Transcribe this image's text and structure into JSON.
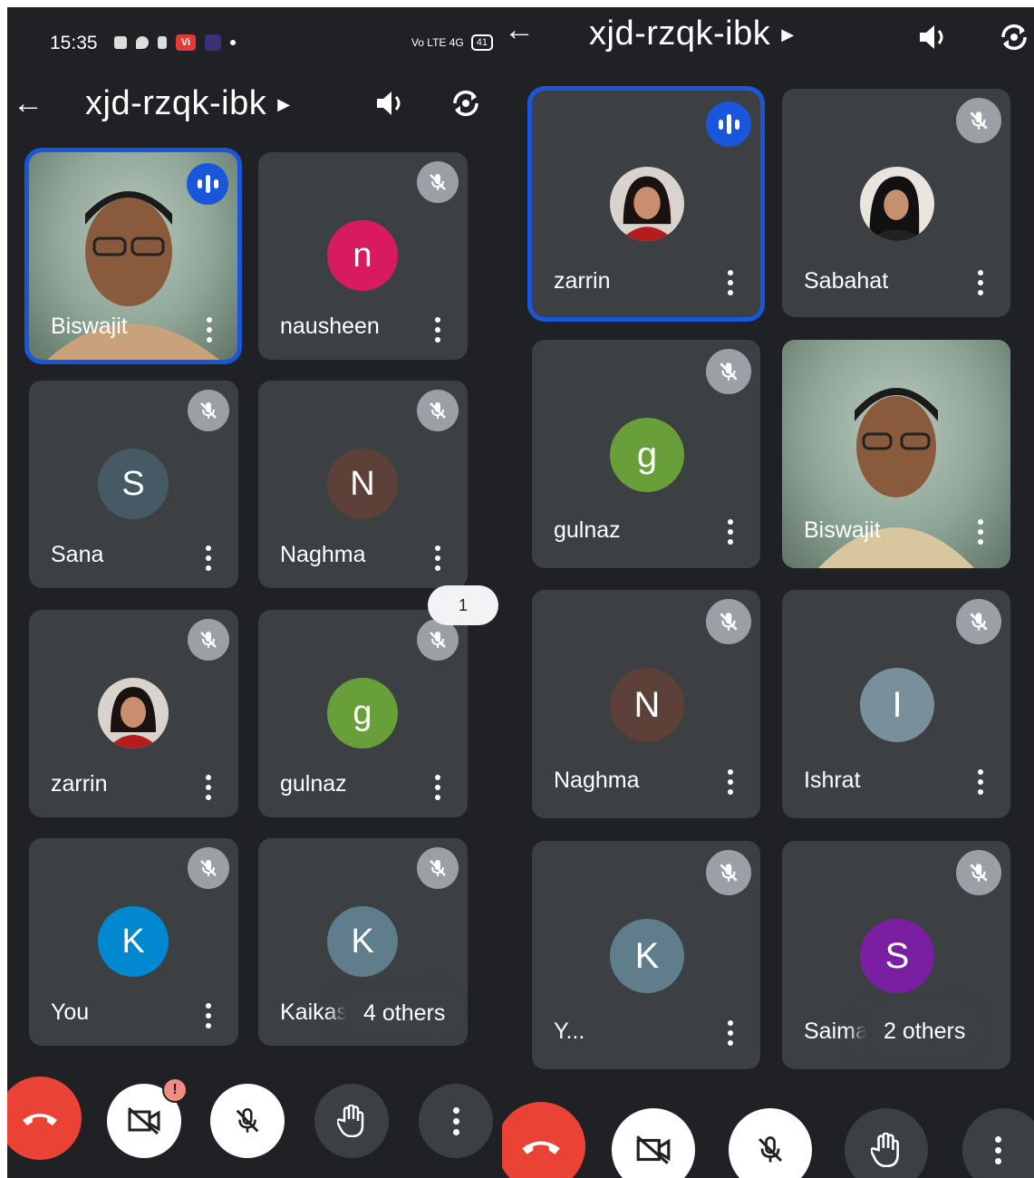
{
  "left": {
    "status": {
      "time": "15:35",
      "vi_badge": "Vi",
      "net": "Vo LTE 4G",
      "battery": "41"
    },
    "header": {
      "title": "xjd-rzqk-ibk",
      "back_icon": "back-arrow-icon",
      "speaker_icon": "speaker-icon",
      "switch_icon": "switch-camera-icon"
    },
    "tiles": [
      {
        "name": "Biswajit",
        "type": "video",
        "status": "speaking"
      },
      {
        "name": "nausheen",
        "type": "avatar",
        "initial": "n",
        "color": "#d81b60",
        "status": "muted"
      },
      {
        "name": "Sana",
        "type": "avatar",
        "initial": "S",
        "color": "#455a64",
        "status": "muted"
      },
      {
        "name": "Naghma",
        "type": "avatar",
        "initial": "N",
        "color": "#5d4037",
        "status": "muted"
      },
      {
        "name": "zarrin",
        "type": "photo",
        "status": "muted"
      },
      {
        "name": "gulnaz",
        "type": "avatar",
        "initial": "g",
        "color": "#689f38",
        "status": "muted"
      },
      {
        "name": "You",
        "type": "avatar",
        "initial": "K",
        "color": "#0288d1",
        "status": "muted"
      },
      {
        "name": "Kaikash",
        "type": "avatar",
        "initial": "K",
        "color": "#607d8b",
        "status": "muted",
        "overflow": "4 others"
      }
    ],
    "scroll_indicator": "1",
    "controls": {
      "alert": "!"
    }
  },
  "right": {
    "header": {
      "title": "xjd-rzqk-ibk"
    },
    "tiles": [
      {
        "name": "zarrin",
        "type": "photo",
        "status": "speaking"
      },
      {
        "name": "Sabahat",
        "type": "photo",
        "status": "muted"
      },
      {
        "name": "gulnaz",
        "type": "avatar",
        "initial": "g",
        "color": "#689f38",
        "status": "muted"
      },
      {
        "name": "Biswajit",
        "type": "video",
        "status": "none"
      },
      {
        "name": "Naghma",
        "type": "avatar",
        "initial": "N",
        "color": "#5d4037",
        "status": "muted"
      },
      {
        "name": "Ishrat",
        "type": "avatar",
        "initial": "I",
        "color": "#78909c",
        "status": "muted"
      },
      {
        "name": "Y...",
        "type": "avatar",
        "initial": "K",
        "color": "#607d8b",
        "status": "muted"
      },
      {
        "name": "Saima",
        "type": "avatar",
        "initial": "S",
        "color": "#7b1fa2",
        "status": "muted",
        "overflow": "2 others"
      }
    ]
  }
}
